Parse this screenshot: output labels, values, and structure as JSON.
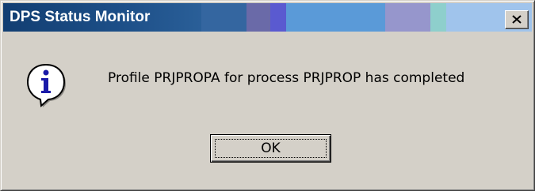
{
  "window": {
    "title": "DPS Status Monitor"
  },
  "titlebar_colors": [
    "#1a4f86",
    "#3466a0",
    "#6a6aa8",
    "#5a5ad0",
    "#5a9ad8",
    "#9696cc",
    "#8ecfcc",
    "#a0c4ec"
  ],
  "dialog": {
    "icon": "information-icon",
    "message": "Profile PRJPROPA for process PRJPROP has completed"
  },
  "buttons": {
    "ok_label": "OK",
    "close_icon": "close-icon"
  }
}
